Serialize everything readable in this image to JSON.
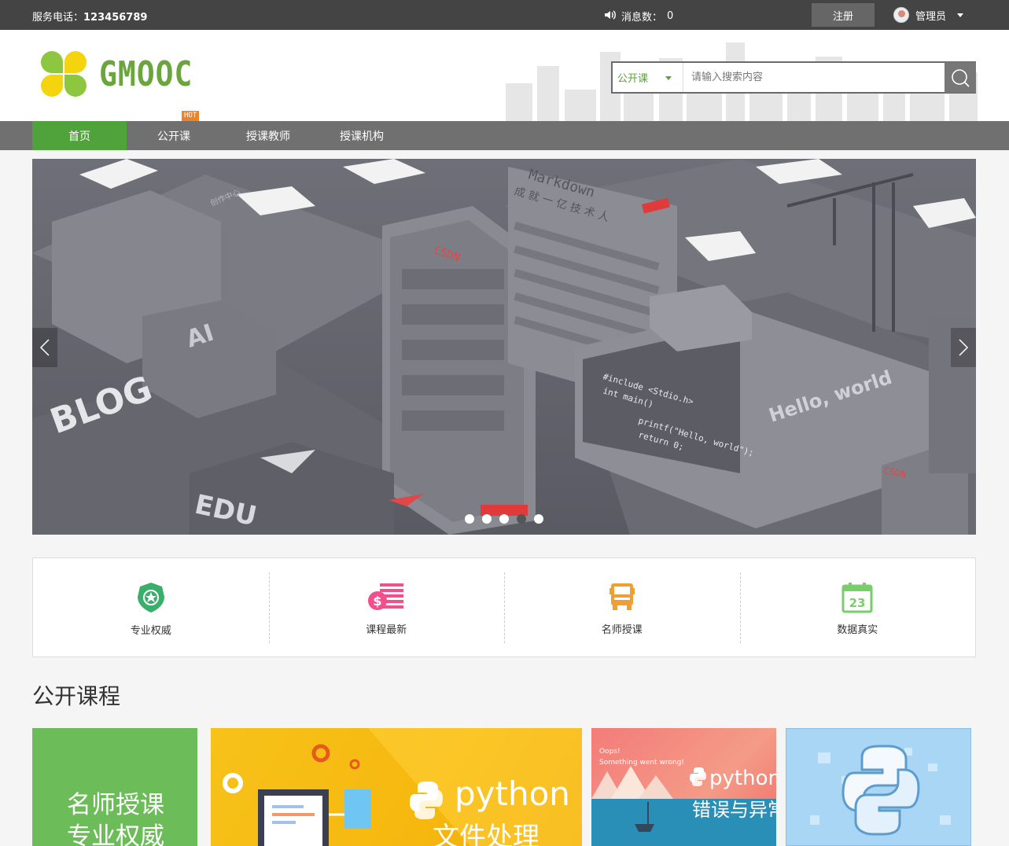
{
  "topbar": {
    "phone_label": "服务电话：",
    "phone_number": "123456789",
    "messages_label": "消息数：",
    "messages_count": "0",
    "register": "注册",
    "user_name": "管理员"
  },
  "header": {
    "logo_text": "GMOOC",
    "search_scope": "公开课",
    "search_placeholder": "请输入搜索内容"
  },
  "nav": {
    "items": [
      {
        "label": "首页",
        "active": true
      },
      {
        "label": "公开课",
        "active": false
      },
      {
        "label": "授课教师",
        "active": false
      },
      {
        "label": "授课机构",
        "active": false
      }
    ],
    "hot_badge": "HOT"
  },
  "banner": {
    "dot_count": 5,
    "active_dot_index": 3,
    "scene_text": {
      "markdown": "Markdown",
      "csdn_a": "CSDN",
      "csdn_b": "CSDN",
      "ai": "AI",
      "blog": "BLOG",
      "edu": "EDU",
      "code1": "#include <Stdio.h>",
      "code2": "int main()",
      "code3": "printf(\"Hello, world\");",
      "code4": "return 0;",
      "hello": "Hello, world",
      "chinese_tiles": "成 就 一 亿 技 术 人",
      "creator": "创作中心"
    }
  },
  "features": [
    {
      "label": "专业权威",
      "icon": "shield-star-icon",
      "color": "#3aae6b"
    },
    {
      "label": "课程最新",
      "icon": "money-stack-icon",
      "color": "#f24f8c"
    },
    {
      "label": "名师授课",
      "icon": "truck-icon",
      "color": "#f0a033"
    },
    {
      "label": "数据真实",
      "icon": "calendar-icon",
      "color": "#7acd6b"
    }
  ],
  "section": {
    "title": "公开课程"
  },
  "cards": {
    "promo_line1": "名师授课",
    "promo_line2": "专业权威",
    "python_file": "python",
    "python_file_sub": "文件处理",
    "oops_line1": "Oops!",
    "oops_line2": "Something went wrong!",
    "python_err": "python",
    "python_err_sub": "错误与异常"
  },
  "colors": {
    "topbar": "#444444",
    "nav": "#707070",
    "accent_green": "#4fa33a",
    "logo_green": "#6aa53d",
    "logo_yellow": "#f4d40c"
  }
}
